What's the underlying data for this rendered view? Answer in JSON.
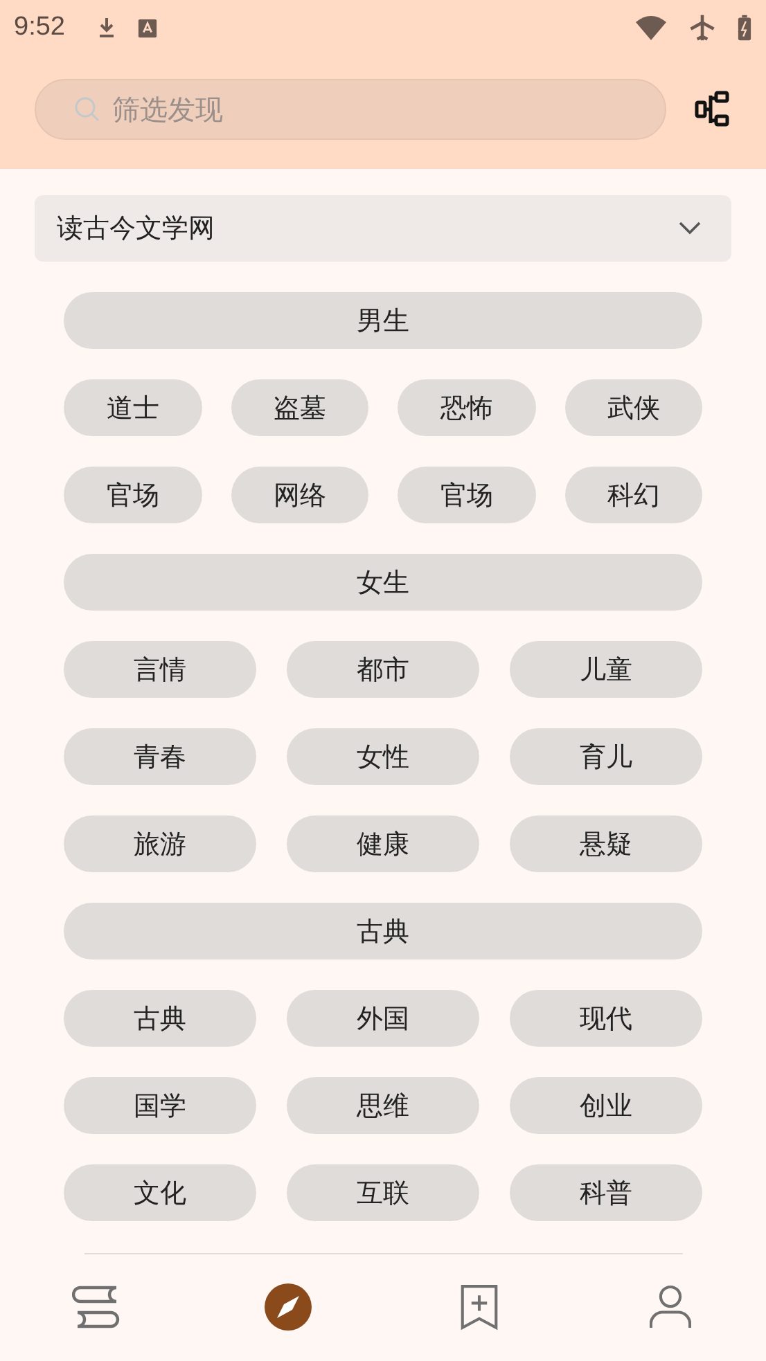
{
  "status_bar": {
    "time": "9:52"
  },
  "search": {
    "placeholder": "筛选发现"
  },
  "source": {
    "label": "读古今文学网",
    "expanded": false
  },
  "groups": [
    {
      "title": "男生",
      "kind": "quad",
      "tags": [
        "道士",
        "盗墓",
        "恐怖",
        "武侠",
        "官场",
        "网络",
        "官场",
        "科幻"
      ]
    },
    {
      "title": "女生",
      "kind": "triple",
      "tags": [
        "言情",
        "都市",
        "儿童",
        "青春",
        "女性",
        "育儿",
        "旅游",
        "健康",
        "悬疑"
      ]
    },
    {
      "title": "古典",
      "kind": "triple",
      "tags": [
        "古典",
        "外国",
        "现代",
        "国学",
        "思维",
        "创业",
        "文化",
        "互联",
        "科普"
      ]
    }
  ],
  "nav": [
    {
      "kind": "bookshelf",
      "selected": false
    },
    {
      "kind": "explore",
      "selected": true
    },
    {
      "kind": "subscribe",
      "selected": false
    },
    {
      "kind": "profile",
      "selected": false
    }
  ]
}
